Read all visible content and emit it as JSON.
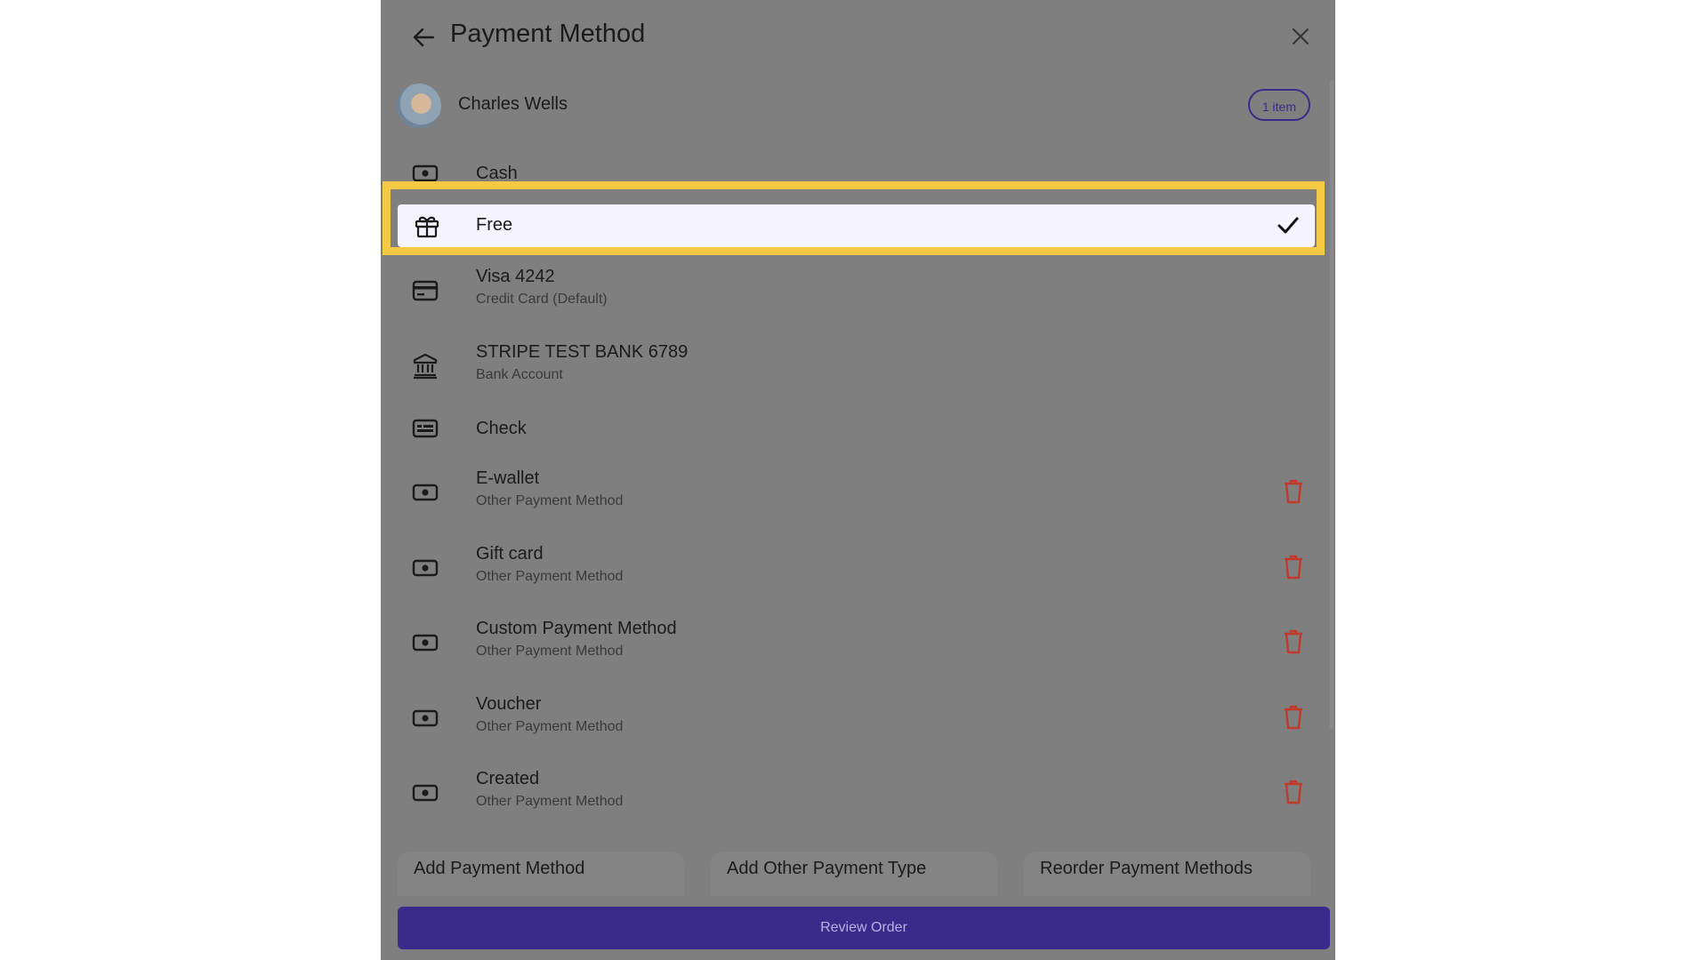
{
  "header": {
    "title": "Payment Method"
  },
  "customer": {
    "name": "Charles Wells",
    "items_badge": "1 item"
  },
  "payment_methods": [
    {
      "name": "Cash",
      "subtitle": "",
      "icon": "cash-icon",
      "deletable": false
    },
    {
      "name": "Free",
      "subtitle": "",
      "icon": "gift-icon",
      "selected": true,
      "deletable": false
    },
    {
      "name": "Visa 4242",
      "subtitle": "Credit Card (Default)",
      "icon": "credit-card-icon",
      "deletable": false
    },
    {
      "name": "STRIPE TEST BANK 6789",
      "subtitle": "Bank Account",
      "icon": "bank-icon",
      "deletable": false
    },
    {
      "name": "Check",
      "subtitle": "",
      "icon": "check-icon",
      "deletable": false
    },
    {
      "name": "E-wallet",
      "subtitle": "Other Payment Method",
      "icon": "cash-icon",
      "deletable": true
    },
    {
      "name": "Gift card",
      "subtitle": "Other Payment Method",
      "icon": "cash-icon",
      "deletable": true
    },
    {
      "name": "Custom Payment Method",
      "subtitle": "Other Payment Method",
      "icon": "cash-icon",
      "deletable": true
    },
    {
      "name": "Voucher",
      "subtitle": "Other Payment Method",
      "icon": "cash-icon",
      "deletable": true
    },
    {
      "name": "Created",
      "subtitle": "Other Payment Method",
      "icon": "cash-icon",
      "deletable": true
    }
  ],
  "actions": {
    "add_payment_method": "Add Payment Method",
    "add_other_payment_type": "Add Other Payment Type",
    "reorder_payment_methods": "Reorder Payment Methods"
  },
  "footer": {
    "review_order": "Review Order"
  },
  "colors": {
    "highlight": "#f6c945",
    "primary": "#3a2a8c",
    "delete": "#c0392b"
  }
}
